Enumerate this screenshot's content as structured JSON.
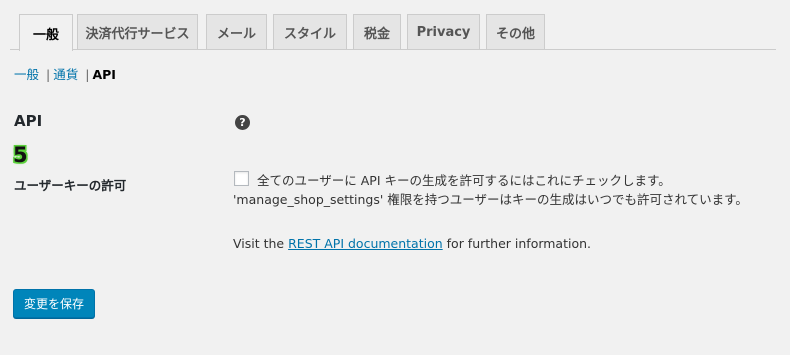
{
  "tabs": [
    {
      "label": "一般",
      "active": true
    },
    {
      "label": "決済代行サービス"
    },
    {
      "label": "メール"
    },
    {
      "label": "スタイル"
    },
    {
      "label": "税金"
    },
    {
      "label": "Privacy"
    },
    {
      "label": "その他"
    }
  ],
  "subnav": {
    "general": "一般",
    "currency": "通貨",
    "api": "API",
    "separator": "|"
  },
  "section": {
    "title": "API",
    "help_icon": "?"
  },
  "step_badge": "5",
  "setting": {
    "label": "ユーザーキーの許可",
    "checkbox_checked": false,
    "checkbox_label": "全てのユーザーに API キーの生成を許可するにはこれにチェックします。",
    "description": "'manage_shop_settings' 権限を持つユーザーはキーの生成はいつでも許可されています。"
  },
  "docs": {
    "prefix": "Visit the ",
    "link_text": "REST API documentation",
    "suffix": " for further information."
  },
  "save_button": "変更を保存",
  "colors": {
    "link": "#0073aa",
    "primary_button": "#0085ba",
    "badge_outline": "#5bd13b"
  }
}
